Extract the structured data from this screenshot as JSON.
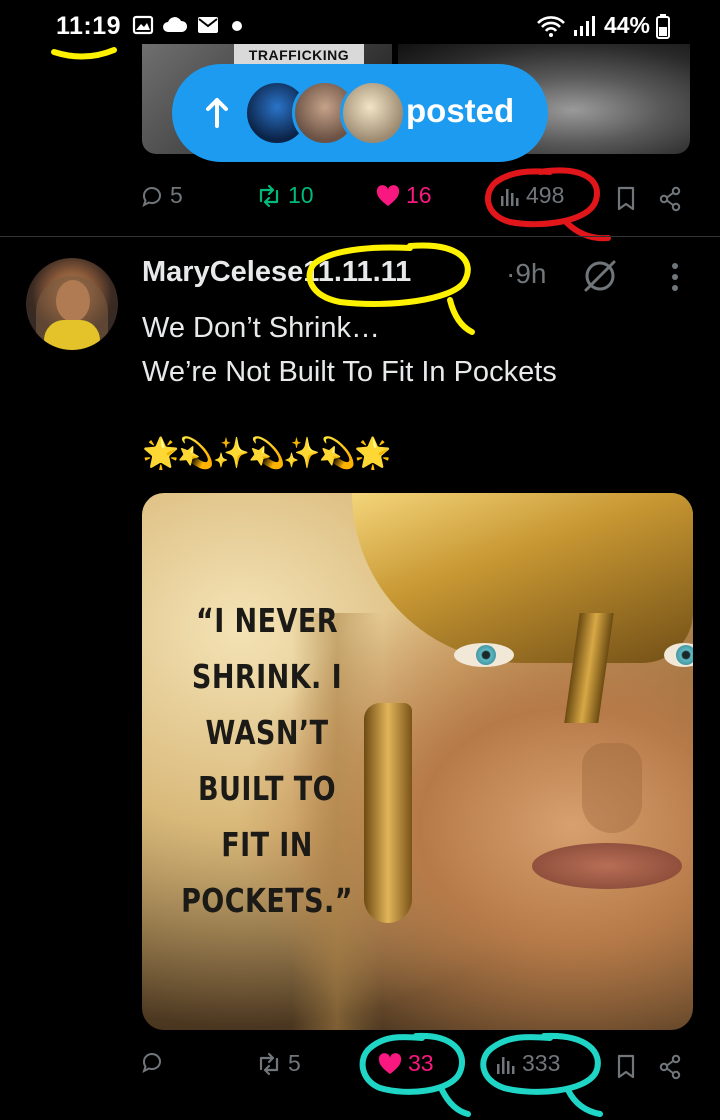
{
  "status_bar": {
    "time": "11:19",
    "battery_percent": "44%",
    "left_icons": [
      "gallery-icon",
      "cloud-icon",
      "mail-icon",
      "dot-icon"
    ],
    "right_icons": [
      "wifi-icon",
      "signal-icon",
      "battery-icon"
    ]
  },
  "top_tweet": {
    "media_banner_text": "TRAFFICKING",
    "actions": {
      "replies": "5",
      "reposts": "10",
      "likes": "16",
      "views": "498"
    }
  },
  "posted_pill": {
    "label": "posted"
  },
  "tweet": {
    "display_name": "MaryCeleste11.11.11",
    "display_name_parts": [
      "MaryCeles",
      "e11.11.11"
    ],
    "time": "·9h",
    "text_lines": [
      "We Don’t Shrink…",
      "We’re Not Built To Fit In Pockets"
    ],
    "emoji_line": "🌟💫✨💫✨💫🌟",
    "image_quote_lines": [
      "“I NEVER",
      "SHRINK. I",
      "WASN’T",
      "BUILT TO",
      "FIT IN",
      "POCKETS.”"
    ],
    "actions": {
      "replies": "",
      "reposts": "5",
      "likes": "33",
      "views": "333"
    }
  },
  "colors": {
    "accent": "#1d9bf0",
    "like": "#f91880",
    "repost": "#00ba7c",
    "muted": "#71767b",
    "annotation_yellow": "#fff200",
    "annotation_red": "#e0161b",
    "annotation_teal": "#1fd6c6"
  }
}
